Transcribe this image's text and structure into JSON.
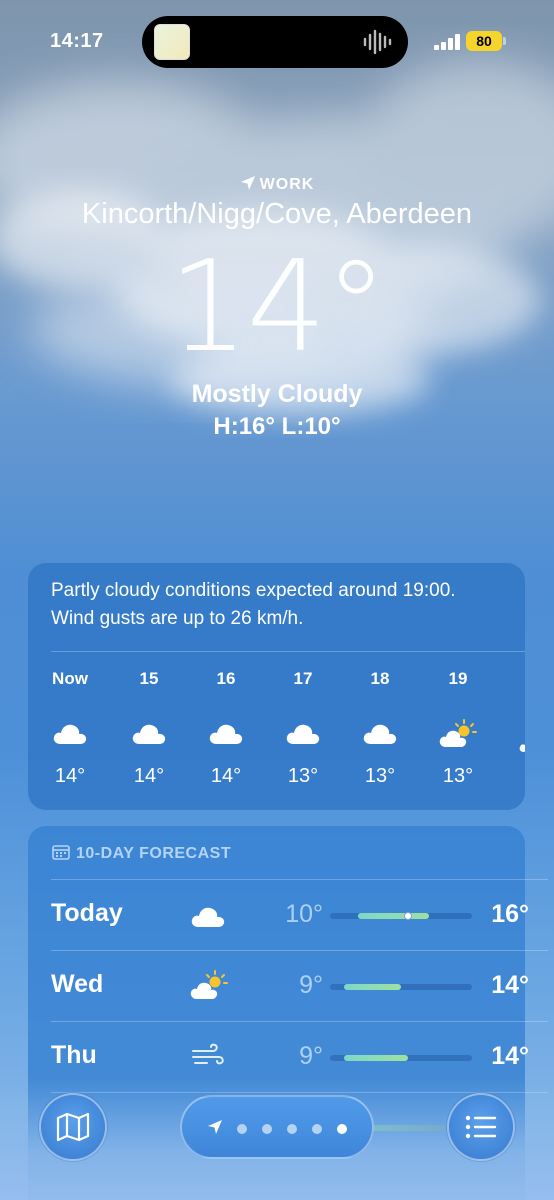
{
  "status": {
    "time": "14:17",
    "battery": "80"
  },
  "header": {
    "location_tag": "WORK",
    "city": "Kincorth/Nigg/Cove, Aberdeen",
    "temperature": "14°",
    "condition": "Mostly Cloudy",
    "hilo": "H:16°  L:10°"
  },
  "hourly": {
    "summary": "Partly cloudy conditions expected around 19:00. Wind gusts are up to 26 km/h.",
    "hours": [
      {
        "label": "Now",
        "icon": "cloud-icon",
        "temp": "14°"
      },
      {
        "label": "15",
        "icon": "cloud-icon",
        "temp": "14°"
      },
      {
        "label": "16",
        "icon": "cloud-icon",
        "temp": "14°"
      },
      {
        "label": "17",
        "icon": "cloud-icon",
        "temp": "13°"
      },
      {
        "label": "18",
        "icon": "cloud-icon",
        "temp": "13°"
      },
      {
        "label": "19",
        "icon": "partly-sunny-icon",
        "temp": "13°"
      }
    ]
  },
  "forecast": {
    "title": "10-DAY FORECAST",
    "days": [
      {
        "day": "Today",
        "icon": "cloud-icon",
        "low": "10°",
        "high": "16°",
        "range_start": 0.2,
        "range_end": 0.7,
        "current": 0.55
      },
      {
        "day": "Wed",
        "icon": "partly-sunny-icon",
        "low": "9°",
        "high": "14°",
        "range_start": 0.1,
        "range_end": 0.5
      },
      {
        "day": "Thu",
        "icon": "wind-icon",
        "low": "9°",
        "high": "14°",
        "range_start": 0.1,
        "range_end": 0.55
      }
    ]
  },
  "colors": {
    "battery": "#f5d52b",
    "bar_start": "#7ed8c7",
    "bar_end": "#9ee0a0"
  }
}
